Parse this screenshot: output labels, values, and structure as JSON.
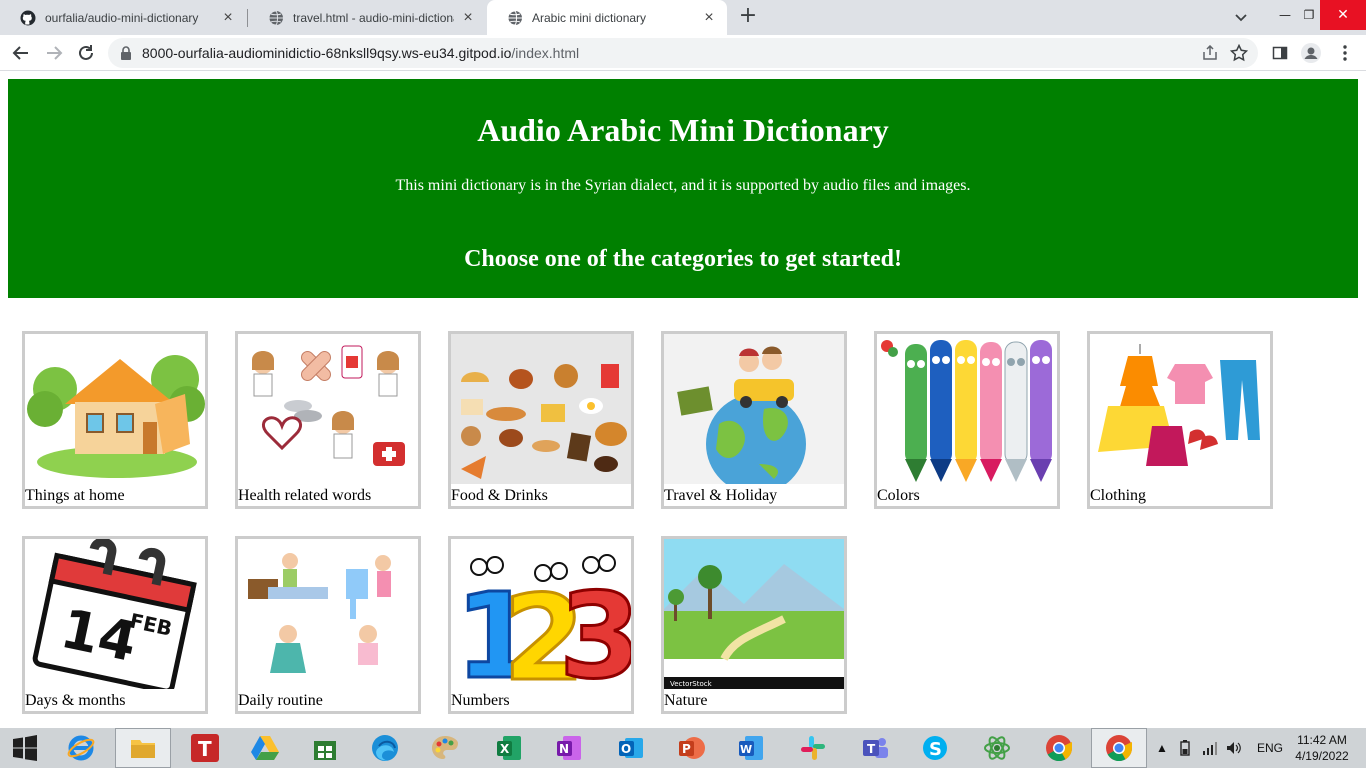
{
  "browser": {
    "tabs": [
      {
        "title": "ourfalia/audio-mini-dictionary",
        "icon": "github-icon"
      },
      {
        "title": "travel.html - audio-mini-dictionar",
        "icon": "globe-icon"
      },
      {
        "title": "Arabic mini dictionary",
        "icon": "globe-icon"
      }
    ],
    "url_host": "8000-ourfalia-audiominidictio-68nksll9qsy.ws-eu34.gitpod.io",
    "url_path": "/index.html"
  },
  "page": {
    "title": "Audio Arabic Mini Dictionary",
    "subtitle": "This mini dictionary is in the Syrian dialect, and it is supported by audio files and images.",
    "call_to_action": "Choose one of the categories to get started!",
    "categories": [
      {
        "label": "Things at home",
        "icon": "house-illustration"
      },
      {
        "label": "Health related words",
        "icon": "health-illustration"
      },
      {
        "label": "Food & Drinks",
        "icon": "food-illustration"
      },
      {
        "label": "Travel & Holiday",
        "icon": "travel-illustration"
      },
      {
        "label": "Colors",
        "icon": "crayons-illustration"
      },
      {
        "label": "Clothing",
        "icon": "clothing-illustration"
      },
      {
        "label": "Days & months",
        "icon": "calendar-illustration",
        "calendar_day": "14",
        "calendar_month": "FEB"
      },
      {
        "label": "Daily routine",
        "icon": "daily-routine-illustration"
      },
      {
        "label": "Numbers",
        "icon": "numbers-illustration",
        "digits": [
          "1",
          "2",
          "3"
        ]
      },
      {
        "label": "Nature",
        "icon": "nature-illustration",
        "watermark": "VectorStock"
      }
    ],
    "colors": {
      "hero_bg": "#008000",
      "hero_text": "#ffffff",
      "card_border": "#cccccc"
    }
  },
  "taskbar": {
    "language": "ENG",
    "time": "11:42 AM",
    "date": "4/19/2022"
  }
}
